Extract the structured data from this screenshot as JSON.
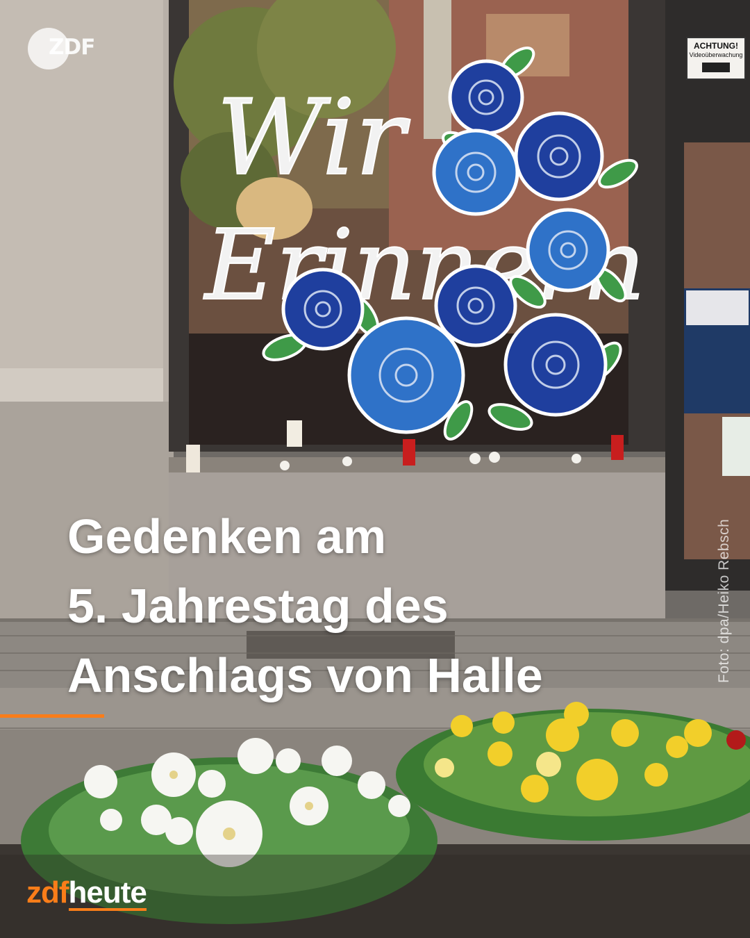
{
  "post": {
    "headline_lines": [
      "Gedenken am",
      "5. Jahrestag des",
      "Anschlags von Halle"
    ],
    "photo_credit": "Foto: dpa/Heiko Rebsch"
  },
  "logo": {
    "text": "ZDF",
    "icon": "zdf-logo-icon"
  },
  "window_art": {
    "text": "Wir Erinnern"
  },
  "sign": {
    "line1": "ACHTUNG!",
    "line2": "Videoüberwachung"
  },
  "brand": {
    "part1": "zdf",
    "part2": "heute"
  },
  "colors": {
    "accent": "#fa7d19",
    "headline": "#ffffff",
    "rose_dark": "#1f3f9e",
    "rose_light": "#2f72c8",
    "leaf": "#3f9a48",
    "wall": "#b6aea6"
  }
}
